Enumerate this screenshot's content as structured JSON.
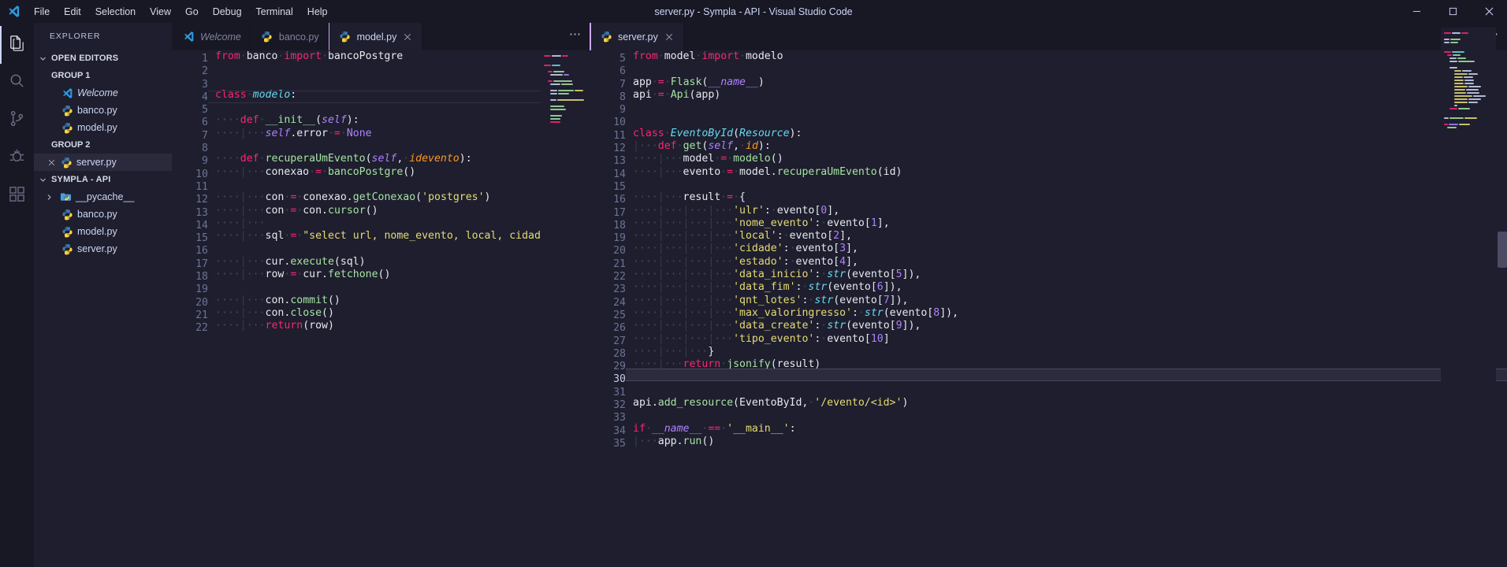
{
  "window": {
    "title": "server.py - Sympla - API - Visual Studio Code",
    "logo_icon": "vscode-logo-icon",
    "minimize_icon": "minimize-icon",
    "maximize_icon": "maximize-icon",
    "close_icon": "close-icon"
  },
  "menu": [
    {
      "label": "File"
    },
    {
      "label": "Edit"
    },
    {
      "label": "Selection"
    },
    {
      "label": "View"
    },
    {
      "label": "Go"
    },
    {
      "label": "Debug"
    },
    {
      "label": "Terminal"
    },
    {
      "label": "Help"
    }
  ],
  "activitybar": [
    {
      "name": "explorer",
      "icon": "files-icon",
      "active": true
    },
    {
      "name": "search",
      "icon": "search-icon",
      "active": false
    },
    {
      "name": "source-control",
      "icon": "source-control-icon",
      "active": false
    },
    {
      "name": "debug",
      "icon": "debug-icon",
      "active": false
    },
    {
      "name": "extensions",
      "icon": "extensions-icon",
      "active": false
    }
  ],
  "sidebar": {
    "title": "EXPLORER",
    "sections": [
      {
        "label": "OPEN EDITORS",
        "expanded": true,
        "groups": [
          {
            "label": "GROUP 1",
            "items": [
              {
                "label": "Welcome",
                "icon": "vscode-logo-icon",
                "italic": true,
                "selected": false
              },
              {
                "label": "banco.py",
                "icon": "python-icon",
                "italic": false,
                "selected": false
              },
              {
                "label": "model.py",
                "icon": "python-icon",
                "italic": false,
                "selected": false
              }
            ]
          },
          {
            "label": "GROUP 2",
            "items": [
              {
                "label": "server.py",
                "icon": "python-icon",
                "italic": false,
                "selected": true,
                "close": "close-icon"
              }
            ]
          }
        ]
      },
      {
        "label": "SYMPLA - API",
        "expanded": true,
        "files": [
          {
            "label": "__pycache__",
            "icon": "folder-python-icon",
            "chevron": "chevron-right-icon",
            "type": "folder"
          },
          {
            "label": "banco.py",
            "icon": "python-icon",
            "type": "file"
          },
          {
            "label": "model.py",
            "icon": "python-icon",
            "type": "file"
          },
          {
            "label": "server.py",
            "icon": "python-icon",
            "type": "file"
          }
        ]
      }
    ]
  },
  "editor_groups": [
    {
      "name": "group-1",
      "tabs": [
        {
          "label": "Welcome",
          "icon": "vscode-logo-icon",
          "active": false,
          "italic": true
        },
        {
          "label": "banco.py",
          "icon": "python-icon",
          "active": false,
          "italic": false
        },
        {
          "label": "model.py",
          "icon": "python-icon",
          "active": true,
          "italic": false,
          "close": "close-icon"
        }
      ],
      "tab_actions": {
        "more": "ellipsis-icon"
      },
      "filename": "model.py",
      "first_line": 1,
      "lines": [
        "from banco import bancoPostgre",
        "",
        "",
        "class modelo:",
        "",
        "    def __init__(self):",
        "        self.error = None",
        "",
        "    def recuperaUmEvento(self, idevento):",
        "        conexao = bancoPostgre()",
        "",
        "        con = conexao.getConexao('postgres')",
        "        cur = con.cursor()",
        "",
        "        sql = \"select url, nome_evento, local, cidade,",
        "",
        "        cur.execute(sql)",
        "        row = cur.fetchone()",
        "",
        "        con.commit()",
        "        con.close()",
        "        return(row)"
      ],
      "highlighted_line": 4
    },
    {
      "name": "group-2",
      "tabs": [
        {
          "label": "server.py",
          "icon": "python-icon",
          "active": true,
          "italic": false,
          "close": "close-icon"
        }
      ],
      "tab_actions": {
        "split": "split-editor-icon",
        "more": "ellipsis-icon"
      },
      "filename": "server.py",
      "first_line": 5,
      "lines": [
        "from model import modelo",
        "",
        "app = Flask(__name__)",
        "api = Api(app)",
        "",
        "",
        "class EventoById(Resource):",
        "    def get(self, id):",
        "        model = modelo()",
        "        evento = model.recuperaUmEvento(id)",
        "",
        "        result = {",
        "                'ulr': evento[0],",
        "                'nome_evento': evento[1],",
        "                'local': evento[2],",
        "                'cidade': evento[3],",
        "                'estado': evento[4],",
        "                'data_inicio': str(evento[5]),",
        "                'data_fim': str(evento[6]),",
        "                'qnt_lotes': str(evento[7]),",
        "                'max_valoringresso': str(evento[8]),",
        "                'data_create': str(evento[9]),",
        "                'tipo_evento': evento[10]",
        "                }",
        "        return jsonify(result)",
        "",
        "",
        "api.add_resource(EventoById, '/evento/<id>')",
        "",
        "if __name__ == '__main__':",
        "    app.run()"
      ],
      "cursor_line": 30
    }
  ],
  "colors": {
    "background": "#1e1e2e",
    "titlebar": "#181825",
    "accent": "#cba6f7",
    "keyword": "#f92672",
    "string": "#e6db74",
    "function": "#a6e3a1",
    "class": "#66d9ef",
    "number": "#ae81ff",
    "python_blue": "#3c78aa",
    "python_yellow": "#ffd43b"
  }
}
